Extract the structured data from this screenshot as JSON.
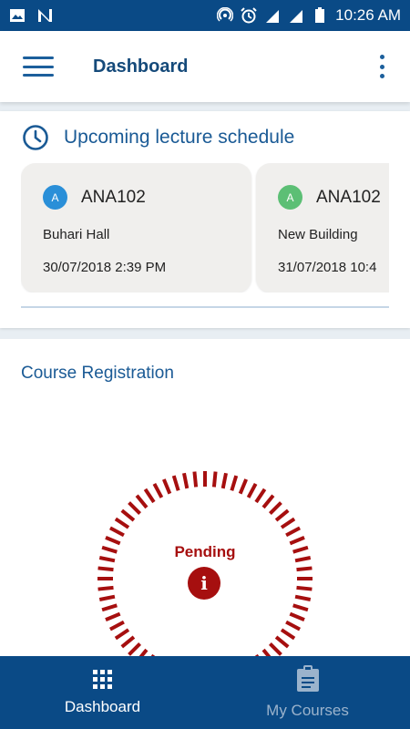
{
  "statusbar": {
    "time": "10:26 AM",
    "icons": [
      "image-icon",
      "n-icon",
      "hotspot-icon",
      "alarm-icon",
      "signal-3g-icon",
      "signal-icon",
      "battery-icon"
    ]
  },
  "appbar": {
    "title": "Dashboard",
    "menu_icon": "hamburger-menu-icon",
    "overflow_icon": "more-vert-icon"
  },
  "lectures": {
    "title": "Upcoming lecture schedule",
    "icon": "clock-icon",
    "cards": [
      {
        "badge": "A",
        "badge_color": "#2a8fd8",
        "course": "ANA102",
        "venue": "Buhari Hall",
        "datetime": "30/07/2018 2:39 PM"
      },
      {
        "badge": "A",
        "badge_color": "#5cbf75",
        "course": "ANA102",
        "venue": "New Building",
        "datetime": "31/07/2018 10:4"
      }
    ]
  },
  "registration": {
    "title": "Course Registration",
    "status": "Pending",
    "status_icon": "info-icon",
    "status_icon_glyph": "i",
    "accent": "#a60f0f"
  },
  "bottomnav": {
    "items": [
      {
        "label": "Dashboard",
        "icon": "apps-grid-icon",
        "active": true
      },
      {
        "label": "My Courses",
        "icon": "clipboard-icon",
        "active": false
      }
    ]
  },
  "colors": {
    "primary": "#0a4a86",
    "title_blue": "#1a5a95"
  }
}
